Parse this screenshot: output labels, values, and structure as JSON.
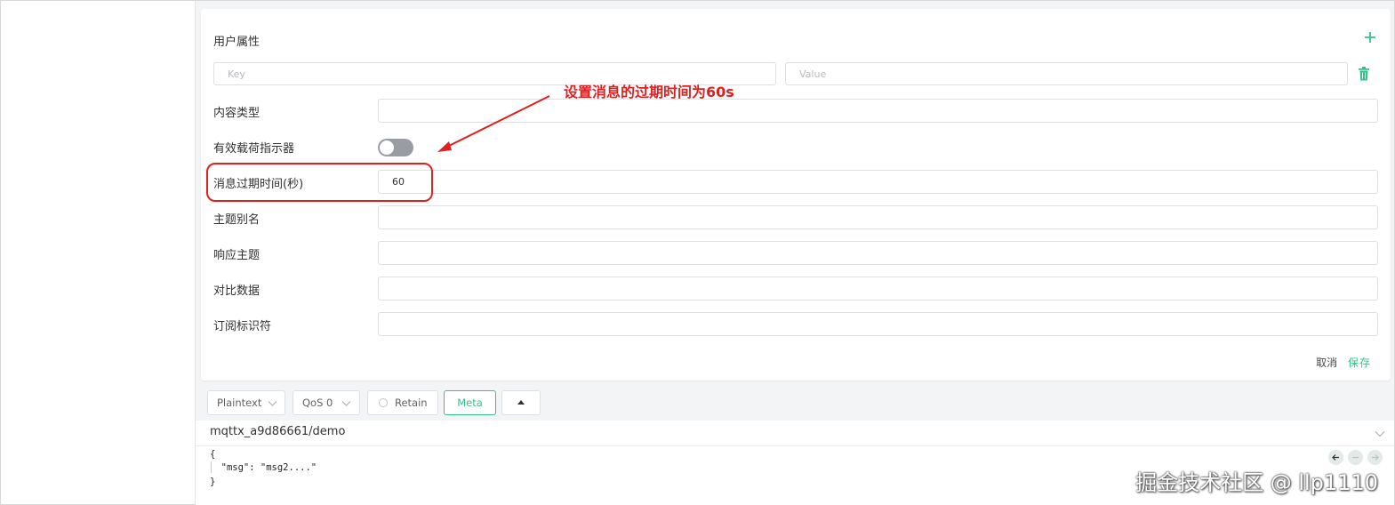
{
  "meta_panel": {
    "title": "用户属性",
    "key_placeholder": "Key",
    "value_placeholder": "Value",
    "fields": [
      {
        "label": "内容类型",
        "value": ""
      },
      {
        "label": "有效载荷指示器",
        "value": ""
      },
      {
        "label": "消息过期时间(秒)",
        "value": "60"
      },
      {
        "label": "主题别名",
        "value": ""
      },
      {
        "label": "响应主题",
        "value": ""
      },
      {
        "label": "对比数据",
        "value": ""
      },
      {
        "label": "订阅标识符",
        "value": ""
      }
    ],
    "payload_indicator_on": false,
    "cancel_label": "取消",
    "save_label": "保存"
  },
  "toolbar": {
    "format": "Plaintext",
    "qos": "QoS 0",
    "retain_label": "Retain",
    "meta_label": "Meta"
  },
  "topic": "mqttx_a9d86661/demo",
  "payload": {
    "line1": "{",
    "line2": "  \"msg\": \"msg2....\"",
    "line3": "}"
  },
  "annotation": {
    "text": "设置消息的过期时间为60s",
    "color": "#e02020"
  },
  "watermark": "掘金技术社区 @ llp1110",
  "colors": {
    "accent": "#34c388",
    "toggle_off": "#999da3",
    "annotation": "#e02020"
  }
}
